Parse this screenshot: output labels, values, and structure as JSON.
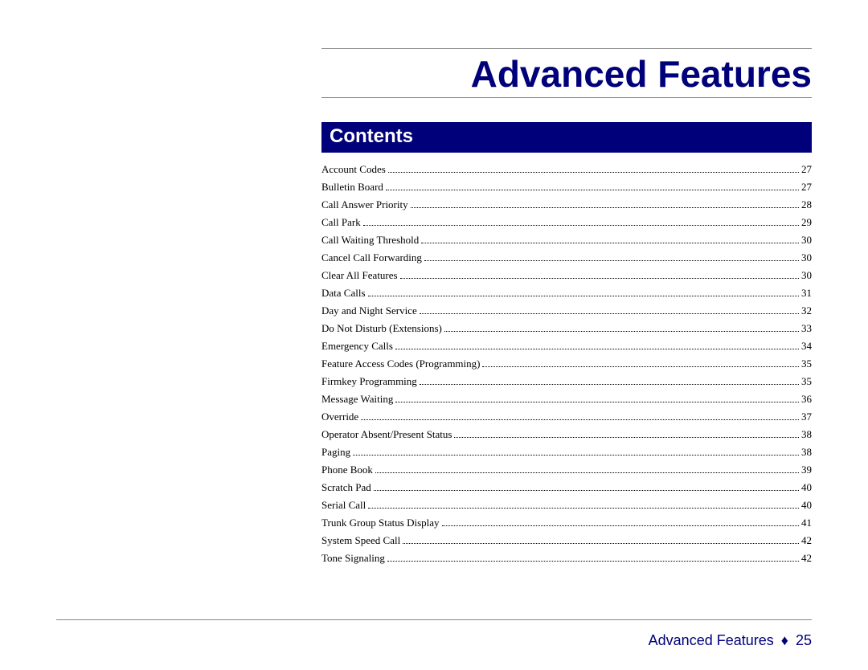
{
  "title": "Advanced Features",
  "section_heading": "Contents",
  "toc": [
    {
      "label": "Account Codes",
      "page": "27"
    },
    {
      "label": "Bulletin Board",
      "page": "27"
    },
    {
      "label": "Call Answer Priority",
      "page": "28"
    },
    {
      "label": "Call Park",
      "page": "29"
    },
    {
      "label": "Call Waiting Threshold",
      "page": "30"
    },
    {
      "label": "Cancel Call Forwarding",
      "page": "30"
    },
    {
      "label": "Clear All Features",
      "page": "30"
    },
    {
      "label": "Data Calls",
      "page": "31"
    },
    {
      "label": "Day and Night Service",
      "page": "32"
    },
    {
      "label": "Do Not Disturb (Extensions)",
      "page": "33"
    },
    {
      "label": "Emergency Calls",
      "page": "34"
    },
    {
      "label": "Feature Access Codes (Programming)",
      "page": "35"
    },
    {
      "label": "Firmkey Programming",
      "page": "35"
    },
    {
      "label": "Message Waiting",
      "page": "36"
    },
    {
      "label": "Override",
      "page": "37"
    },
    {
      "label": "Operator Absent/Present Status",
      "page": "38"
    },
    {
      "label": "Paging",
      "page": "38"
    },
    {
      "label": "Phone Book",
      "page": "39"
    },
    {
      "label": "Scratch Pad",
      "page": "40"
    },
    {
      "label": "Serial Call",
      "page": "40"
    },
    {
      "label": "Trunk Group Status Display",
      "page": "41"
    },
    {
      "label": "System Speed Call",
      "page": "42"
    },
    {
      "label": "Tone Signaling",
      "page": "42"
    }
  ],
  "footer": {
    "section_name": "Advanced Features",
    "page_number": "25",
    "separator_glyph": "♦"
  },
  "colors": {
    "brand_blue": "#00007a"
  }
}
